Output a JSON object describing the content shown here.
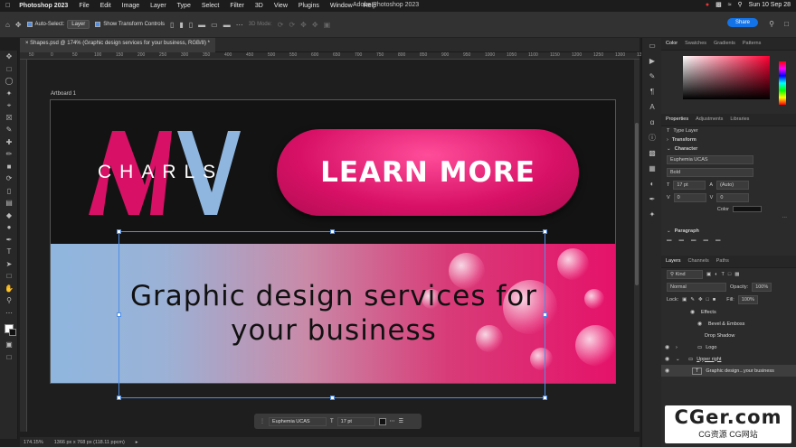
{
  "menubar": {
    "apple": "",
    "app": "Photoshop 2023",
    "items": [
      "File",
      "Edit",
      "Image",
      "Layer",
      "Type",
      "Select",
      "Filter",
      "3D",
      "View",
      "Plugins",
      "Window",
      "Help"
    ],
    "title": "Adobe Photoshop 2023",
    "clock": "Sun 10 Sep  28"
  },
  "options": {
    "auto_select_label": "Auto-Select:",
    "auto_select_value": "Layer",
    "show_transform": "Show Transform Controls",
    "mode3d": "3D Mode:",
    "share": "Share"
  },
  "document": {
    "tab": "Shapes.psd @ 174% (Graphic design services for your business, RGB/8) *",
    "artboard_label": "Artboard 1"
  },
  "ruler": {
    "ticks": [
      "50",
      "0",
      "50",
      "100",
      "150",
      "200",
      "250",
      "300",
      "350",
      "400",
      "450",
      "500",
      "550",
      "600",
      "650",
      "700",
      "750",
      "800",
      "850",
      "900",
      "950",
      "1000",
      "1050",
      "1100",
      "1150",
      "1200",
      "1250",
      "1300",
      "1350"
    ]
  },
  "artwork": {
    "logo_text": "CHARLS",
    "button_text": "LEARN MORE",
    "headline_1": "Graphic  design  services  for",
    "headline_2": "your  business",
    "colors": {
      "magenta": "#d81166",
      "blue": "#8fb6df"
    }
  },
  "context_bar": {
    "font": "Euphemia UCAS",
    "size": "17 pt"
  },
  "status": {
    "zoom": "174.15%",
    "dims": "1366 px x 768 px (118.11 ppcm)"
  },
  "panels": {
    "color_tabs": [
      "Color",
      "Swatches",
      "Gradients",
      "Patterns"
    ],
    "prop_tabs": [
      "Properties",
      "Adjustments",
      "Libraries"
    ],
    "type_layer": "Type Layer",
    "transform": "Transform",
    "character": "Character",
    "font_family": "Euphemia UCAS",
    "font_style": "Bold",
    "font_size": "17 pt",
    "leading": "(Auto)",
    "kerning": "0",
    "tracking": "0",
    "color_label": "Color",
    "paragraph": "Paragraph",
    "layer_tabs": [
      "Layers",
      "Channels",
      "Paths"
    ],
    "kind": "Kind",
    "blend": "Normal",
    "opacity_label": "Opacity:",
    "opacity": "100%",
    "lock_label": "Lock:",
    "fill_label": "Fill:",
    "fill": "100%",
    "layers": [
      "Effects",
      "Bevel & Emboss",
      "Drop Shadow",
      "Logo",
      "Upper right",
      "Graphic design...your business"
    ]
  },
  "watermark": {
    "line1": "CGer.com",
    "line2": "CG资源 CG网站"
  }
}
